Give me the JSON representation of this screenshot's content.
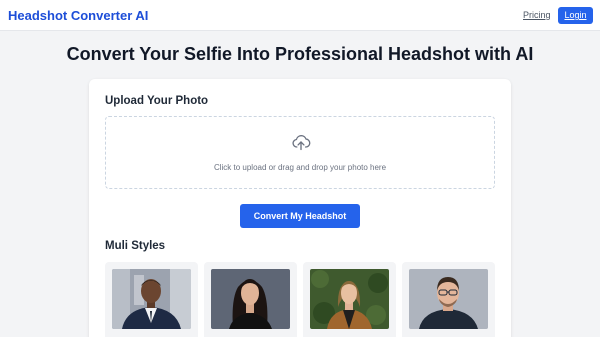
{
  "app": {
    "title": "Headshot Converter AI"
  },
  "nav": {
    "pricing_label": "Pricing",
    "login_label": "Login"
  },
  "hero": {
    "title": "Convert Your Selfie Into Professional Headshot with AI"
  },
  "upload": {
    "heading": "Upload Your Photo",
    "icon": "cloud-upload-icon",
    "instruction": "Click to upload or drag and drop your photo here"
  },
  "convert_button": {
    "label": "Convert My Headshot"
  },
  "styles": {
    "heading": "Muli Styles",
    "items": [
      {
        "label": ""
      },
      {
        "label": ""
      },
      {
        "label": ""
      },
      {
        "label": ""
      }
    ]
  },
  "colors": {
    "brand": "#1d4ed8",
    "primary_button": "#2563eb",
    "page_background": "#f3f4f6",
    "card_background": "#ffffff"
  }
}
